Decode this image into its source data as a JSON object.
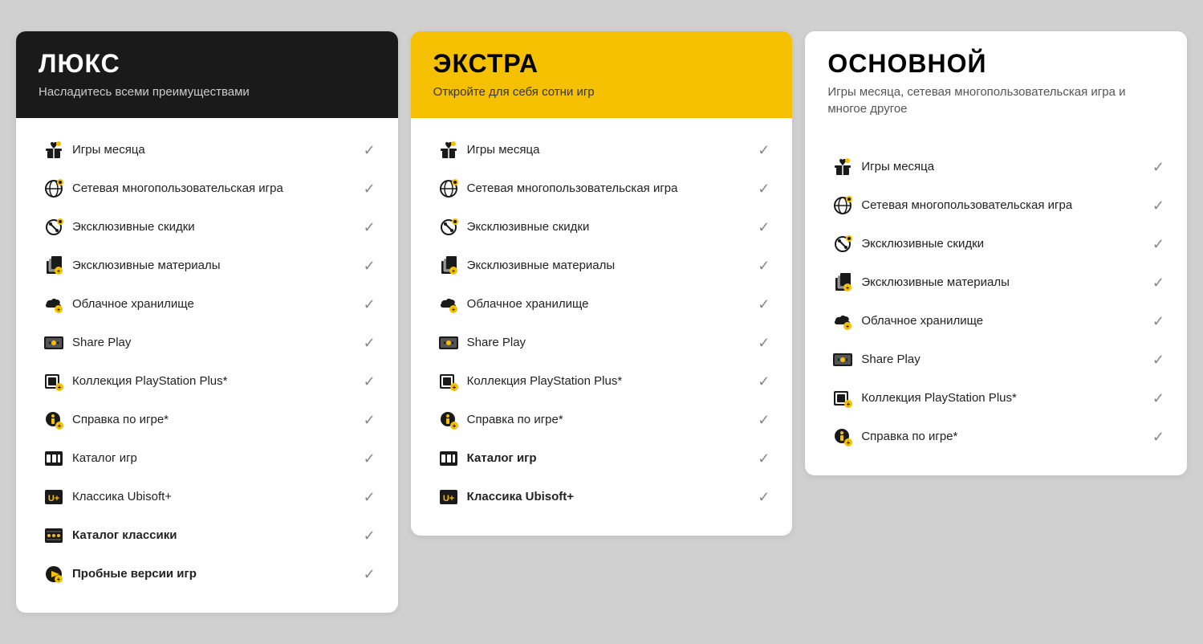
{
  "plans": [
    {
      "id": "lux",
      "headerClass": "dark",
      "title": "ЛЮКС",
      "subtitle": "Насладитесь всеми преимуществами",
      "features": [
        {
          "icon": "gift",
          "label": "Игры месяца",
          "bold": false,
          "check": true
        },
        {
          "icon": "network",
          "label": "Сетевая многопользовательская игра",
          "bold": false,
          "check": true
        },
        {
          "icon": "discount",
          "label": "Эксклюзивные скидки",
          "bold": false,
          "check": true
        },
        {
          "icon": "materials",
          "label": "Эксклюзивные материалы",
          "bold": false,
          "check": true
        },
        {
          "icon": "cloud",
          "label": "Облачное хранилище",
          "bold": false,
          "check": true
        },
        {
          "icon": "shareplay",
          "label": "Share Play",
          "bold": false,
          "check": true
        },
        {
          "icon": "psplus",
          "label": "Коллекция PlayStation Plus*",
          "bold": false,
          "check": true
        },
        {
          "icon": "hint",
          "label": "Справка по игре*",
          "bold": false,
          "check": true
        },
        {
          "icon": "catalog",
          "label": "Каталог игр",
          "bold": false,
          "check": true
        },
        {
          "icon": "ubisoft",
          "label": "Классика Ubisoft+",
          "bold": false,
          "check": true
        },
        {
          "icon": "classics",
          "label": "Каталог классики",
          "bold": true,
          "check": true
        },
        {
          "icon": "trial",
          "label": "Пробные версии игр",
          "bold": true,
          "check": true
        }
      ]
    },
    {
      "id": "extra",
      "headerClass": "yellow",
      "title": "ЭКСТРА",
      "subtitle": "Откройте для себя сотни игр",
      "features": [
        {
          "icon": "gift",
          "label": "Игры месяца",
          "bold": false,
          "check": true
        },
        {
          "icon": "network",
          "label": "Сетевая многопользовательская игра",
          "bold": false,
          "check": true
        },
        {
          "icon": "discount",
          "label": "Эксклюзивные скидки",
          "bold": false,
          "check": true
        },
        {
          "icon": "materials",
          "label": "Эксклюзивные материалы",
          "bold": false,
          "check": true
        },
        {
          "icon": "cloud",
          "label": "Облачное хранилище",
          "bold": false,
          "check": true
        },
        {
          "icon": "shareplay",
          "label": "Share Play",
          "bold": false,
          "check": true
        },
        {
          "icon": "psplus",
          "label": "Коллекция PlayStation Plus*",
          "bold": false,
          "check": true
        },
        {
          "icon": "hint",
          "label": "Справка по игре*",
          "bold": false,
          "check": true
        },
        {
          "icon": "catalog",
          "label": "Каталог игр",
          "bold": true,
          "check": true
        },
        {
          "icon": "ubisoft",
          "label": "Классика Ubisoft+",
          "bold": true,
          "check": true
        }
      ]
    },
    {
      "id": "basic",
      "headerClass": "white",
      "title": "ОСНОВНОЙ",
      "subtitle": "Игры месяца, сетевая многопользовательская игра и многое другое",
      "features": [
        {
          "icon": "gift",
          "label": "Игры месяца",
          "bold": false,
          "check": true
        },
        {
          "icon": "network",
          "label": "Сетевая многопользовательская игра",
          "bold": false,
          "check": true
        },
        {
          "icon": "discount",
          "label": "Эксклюзивные скидки",
          "bold": false,
          "check": true
        },
        {
          "icon": "materials",
          "label": "Эксклюзивные материалы",
          "bold": false,
          "check": true
        },
        {
          "icon": "cloud",
          "label": "Облачное хранилище",
          "bold": false,
          "check": true
        },
        {
          "icon": "shareplay",
          "label": "Share Play",
          "bold": false,
          "check": true
        },
        {
          "icon": "psplus",
          "label": "Коллекция PlayStation Plus*",
          "bold": false,
          "check": true
        },
        {
          "icon": "hint",
          "label": "Справка по игре*",
          "bold": false,
          "check": true
        }
      ]
    }
  ],
  "checkmark": "✓"
}
